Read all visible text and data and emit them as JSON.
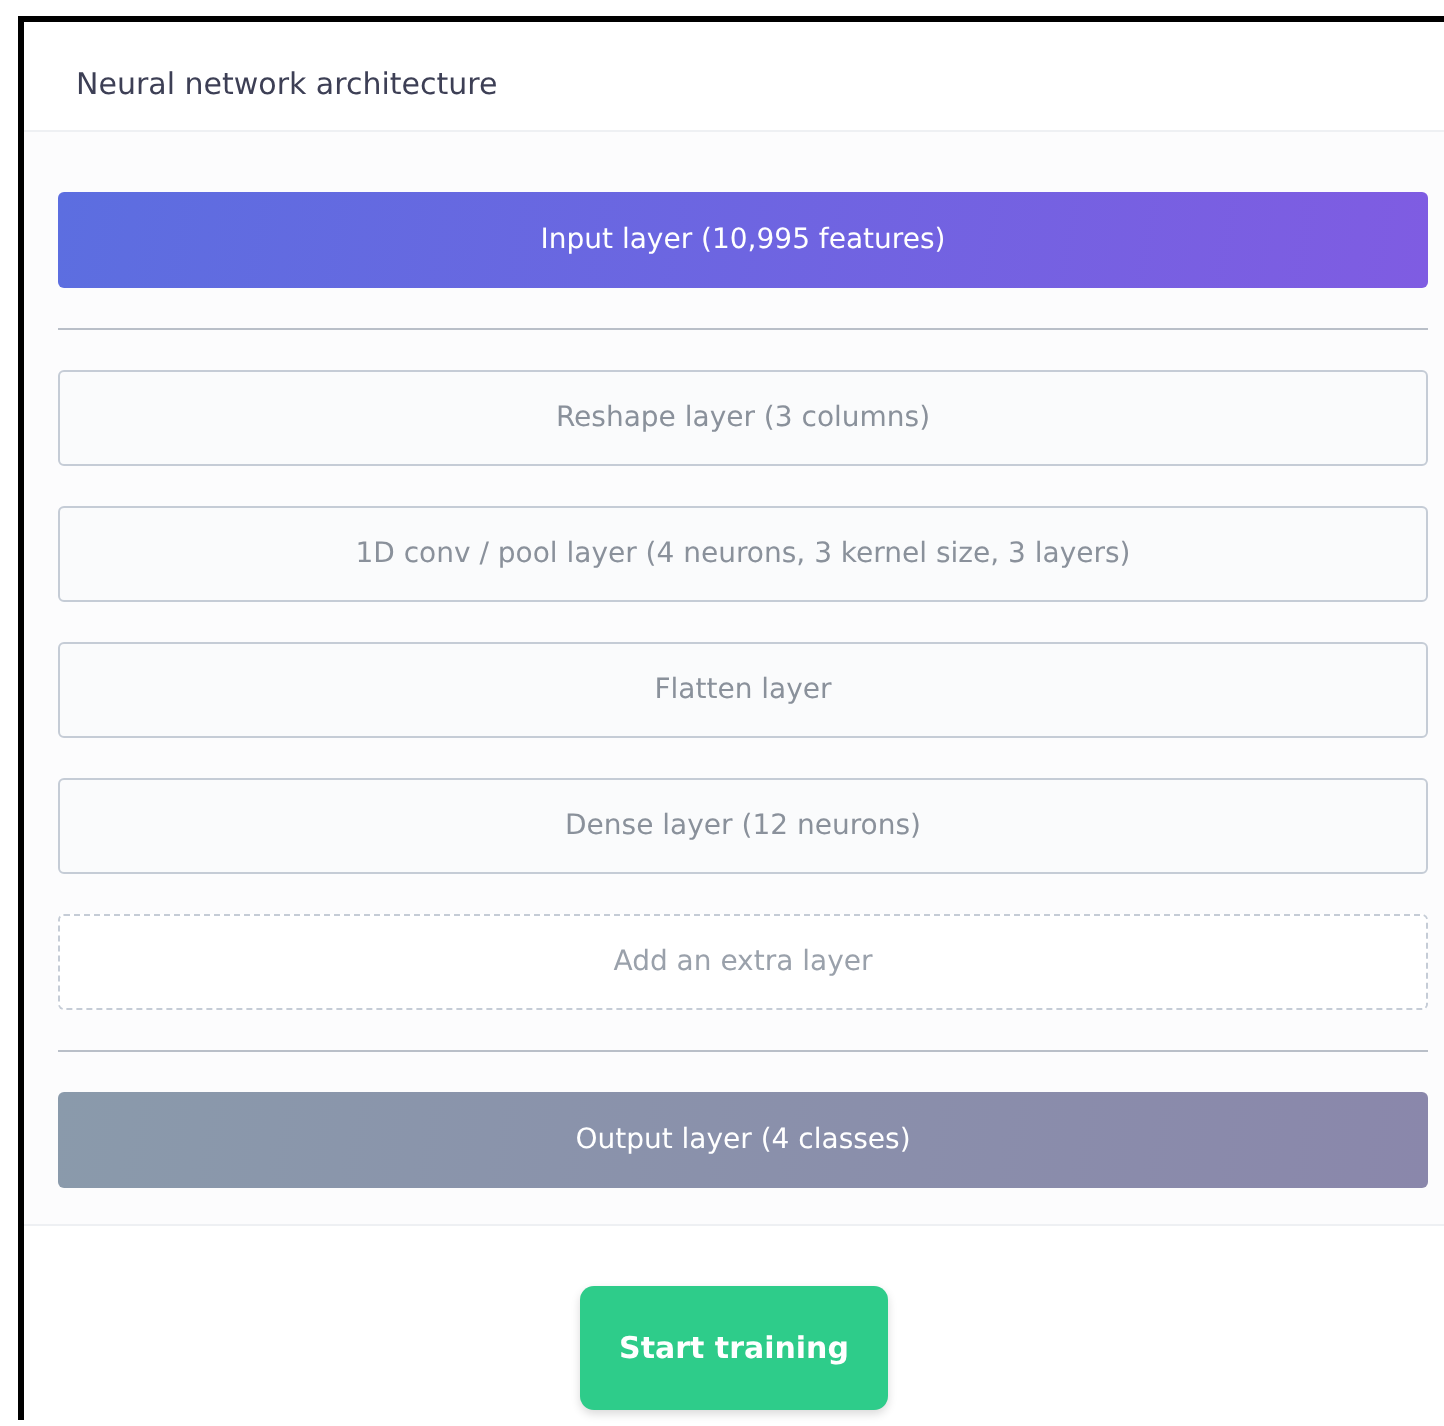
{
  "title": "Neural network architecture",
  "input_layer": {
    "label": "Input layer (10,995 features)"
  },
  "hidden_layers": [
    {
      "label": "Reshape layer (3 columns)"
    },
    {
      "label": "1D conv / pool layer (4 neurons, 3 kernel size, 3 layers)"
    },
    {
      "label": "Flatten layer"
    },
    {
      "label": "Dense layer (12 neurons)"
    }
  ],
  "add_layer": {
    "label": "Add an extra layer"
  },
  "output_layer": {
    "label": "Output layer (4 classes)"
  },
  "start_button": {
    "label": "Start training"
  }
}
